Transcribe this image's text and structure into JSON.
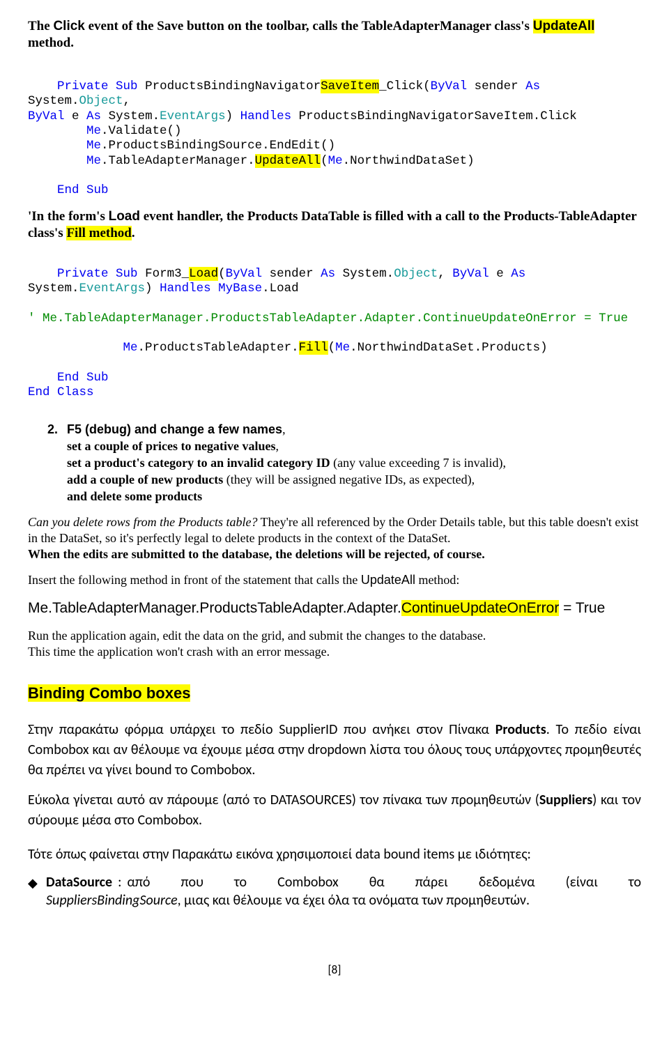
{
  "p1": {
    "t1a": "The ",
    "t1b": "Click",
    "t1c": " event of the Save button on the toolbar, calls the TableAdapterManager class's ",
    "t1d": "UpdateAll",
    "t1e": " method."
  },
  "code1": {
    "indentPrivate": "    ",
    "Private": "Private",
    "Sub": "Sub",
    "subName": " ProductsBindingNavigator",
    "saveItem": "SaveItem",
    "clickSuffix": "_Click(",
    "ByVal": "ByVal",
    "senderAs": " sender ",
    "As": "As",
    "sp": " ",
    "SystemDot": "System.",
    "Object": "Object",
    "comma": ", ",
    "nl": "\n",
    "ByValE": "ByVal",
    "eAs": " e ",
    "EventArgs": "EventArgs",
    "rpar": ")",
    "Handles": "Handles",
    "handlesTarget": " ProductsBindingNavigatorSaveItem.Click",
    "line_me1": "        ",
    "Me": "Me",
    "dotValidate": ".Validate()",
    "dotPBS": ".ProductsBindingSource.EndEdit()",
    "dotTAM": ".TableAdapterManager.",
    "UpdateAll": "UpdateAll",
    "lparen": "(",
    "dotNorthwind": ".NorthwindDataSet)",
    "EndSubIndent": "    ",
    "End": "End",
    "SubWord": "Sub"
  },
  "p2": {
    "t1": "'In the ",
    "t2": "form's ",
    "t3": "Load",
    "t4": " event handler, the Products DataTable is filled with a call to the ",
    "t5": "Products-TableAdapter class's ",
    "t6": "Fill method",
    "t7": "."
  },
  "code2": {
    "indentPrivate": "    ",
    "Private": "Private",
    "Sub": "Sub",
    "form3": " Form3_",
    "Load": "Load",
    "lpar": "(",
    "ByVal": "ByVal",
    "senderAs": " sender ",
    "As": "As",
    "sp": " ",
    "SystemDot": "System.",
    "Object": "Object",
    "comma": ", ",
    "ByValE": "ByVal",
    "eAs": " e ",
    "EventArgs": "EventArgs",
    "rpar": ")",
    "Handles": "Handles",
    "MyBase": "MyBase",
    "dotLoad": ".Load",
    "cmtLine": "' Me.TableAdapterManager.ProductsTableAdapter.Adapter.ContinueUpdateOnError = True",
    "fillIndent": "             ",
    "Me": "Me",
    "dotPTA": ".ProductsTableAdapter.",
    "Fill": "Fill",
    "dotNorthwindProducts": ".NorthwindDataSet.Products)",
    "EndSubIndent": "    ",
    "End": "End",
    "SubWord": "Sub",
    "Class": "Class"
  },
  "step2": {
    "num": "2.",
    "line1a": "F5 (debug) and change a few names",
    "comma": ",",
    "line2": "set a couple of prices to negative values",
    "line3a": "set a product's category to an invalid category ID ",
    "line3b": "(any value exceeding 7 is invalid),",
    "line4a": "add a couple of new products ",
    "line4b": "(they will be assigned negative IDs, as expected),",
    "line5": "and delete some products"
  },
  "p3": {
    "a": "Can you delete rows from the Products table?",
    "b": " They're all referenced by the Order Details table, but this table doesn't exist in the DataSet, so it's perfectly legal to delete products in the context of the DataSet.",
    "c": "When the edits are submitted to the database, the deletions will be rejected, of course."
  },
  "p4": {
    "a": "Insert the following method in front of the statement that calls the ",
    "b": "UpdateAll",
    "c": " method:"
  },
  "bigline": {
    "a": "Me.TableAdapterManager.ProductsTableAdapter.Adapter.",
    "b": "ContinueUpdateOnError",
    "c": " = True"
  },
  "p5": {
    "a": "Run the application again, edit the data on the grid, and submit the changes to the database.",
    "b": "This time the application won't crash with an error message."
  },
  "h2": "Binding Combo boxes",
  "gr1": {
    "a": "Στην παρακάτω φόρμα υπάρχει το πεδίο SupplierID που ανήκει στον Πίνακα ",
    "b": "Products",
    "c": ". Το πεδίο είναι Combobox και αν θέλουμε να έχουμε μέσα στην dropdown λίστα του όλους τους υπάρχοντες προμηθευτές θα πρέπει να γίνει bound το Combobox."
  },
  "gr2": {
    "a": "Εύκολα γίνεται αυτό αν πάρουμε (από το DATASOURCES) τον πίνακα των προμηθευτών (",
    "b": "Suppliers",
    "c": ") και τον σύρουμε μέσα στο Combobox."
  },
  "gr3": "Τότε όπως φαίνεται στην Παρακάτω εικόνα χρησιμοποιεί data bound items με ιδιότητες:",
  "gr4": {
    "dia": "◆",
    "lead": "DataSource",
    "sep": " :",
    "mid": "από που το Combobox θα πάρει δεδομένα (είναι το",
    "end1": "SuppliersBindingSource",
    "end2": ", μιας και θέλουμε να έχει όλα τα ονόματα των προμηθευτών."
  },
  "footer": "[8]"
}
